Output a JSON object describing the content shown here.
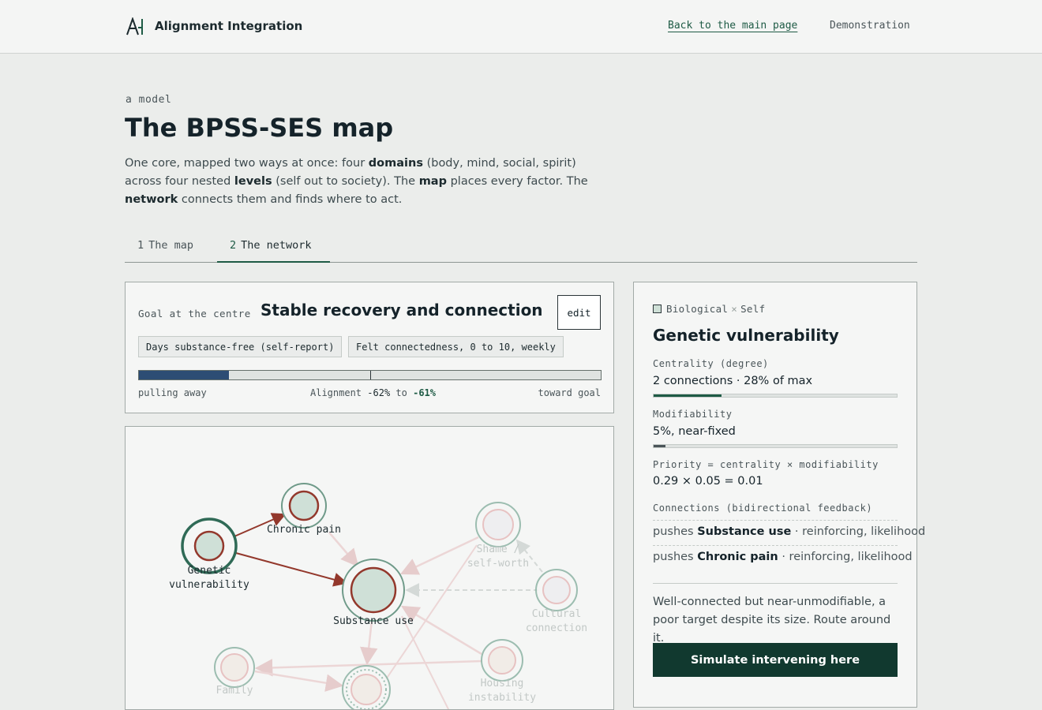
{
  "header": {
    "brand": "Alignment Integration",
    "nav_back": "Back to the main page",
    "nav_demo": "Demonstration"
  },
  "intro": {
    "eyebrow": "a model",
    "title": "The BPSS-SES map",
    "lead": [
      "One core, mapped two ways at once: four ",
      "domains",
      " (body, mind, social, spirit) across four nested ",
      "levels",
      " (self out to society). The ",
      "map",
      " places every factor. The ",
      "network",
      " connects them and finds where to act."
    ]
  },
  "tabs": [
    {
      "num": "1",
      "label": "The map",
      "active": false
    },
    {
      "num": "2",
      "label": "The network",
      "active": true
    }
  ],
  "goal": {
    "label": "Goal at the centre",
    "title": "Stable recovery and connection",
    "edit": "edit",
    "measures": [
      "Days substance-free (self-report)",
      "Felt connectedness, 0 to 10, weekly"
    ],
    "scale_left": "pulling away",
    "scale_right": "toward goal",
    "alignment_label": "Alignment",
    "alignment_from": "-62%",
    "alignment_to_word": "to",
    "alignment_to": "-61%",
    "alignment_fill_fraction": 0.195
  },
  "network": {
    "nodes": [
      {
        "id": "genetic",
        "lines": [
          "Genetic",
          "vulnerability"
        ],
        "state": "selected"
      },
      {
        "id": "pain",
        "lines": [
          "Chronic pain"
        ],
        "state": "linked"
      },
      {
        "id": "substance",
        "lines": [
          "Substance use"
        ],
        "state": "linked"
      },
      {
        "id": "shame",
        "lines": [
          "Shame /",
          "self-worth"
        ],
        "state": "faded"
      },
      {
        "id": "cultural",
        "lines": [
          "Cultural",
          "connection"
        ],
        "state": "faded"
      },
      {
        "id": "family",
        "lines": [
          "Family"
        ],
        "state": "faded"
      },
      {
        "id": "housing",
        "lines": [
          "Housing",
          "instability"
        ],
        "state": "faded"
      },
      {
        "id": "centre",
        "lines": [],
        "state": "faded"
      }
    ]
  },
  "detail": {
    "domain": "Biological",
    "sep": "×",
    "level": "Self",
    "title": "Genetic vulnerability",
    "centrality_label": "Centrality (degree)",
    "centrality_value": "2 connections · 28% of max",
    "centrality_fraction": 0.28,
    "modifiability_label": "Modifiability",
    "modifiability_value": "5%, near-fixed",
    "modifiability_fraction": 0.05,
    "priority_label": "Priority = centrality × modifiability",
    "priority_value": "0.29 × 0.05 = 0.01",
    "connections_label": "Connections (bidirectional feedback)",
    "connections": [
      {
        "verb": "pushes",
        "target": "Substance use",
        "rest": " · reinforcing, likelihood"
      },
      {
        "verb": "pushes",
        "target": "Chronic pain",
        "rest": " · reinforcing, likelihood"
      }
    ],
    "note": "Well-connected but near-unmodifiable, a poor target despite its size. Route around it.",
    "action": "Simulate intervening here"
  },
  "colors": {
    "accent": "#1e5b45",
    "bar_fill": "#2d4d74",
    "arrow_active": "#93382c",
    "node_fill": "#cfe0d7",
    "button": "#11392f"
  }
}
